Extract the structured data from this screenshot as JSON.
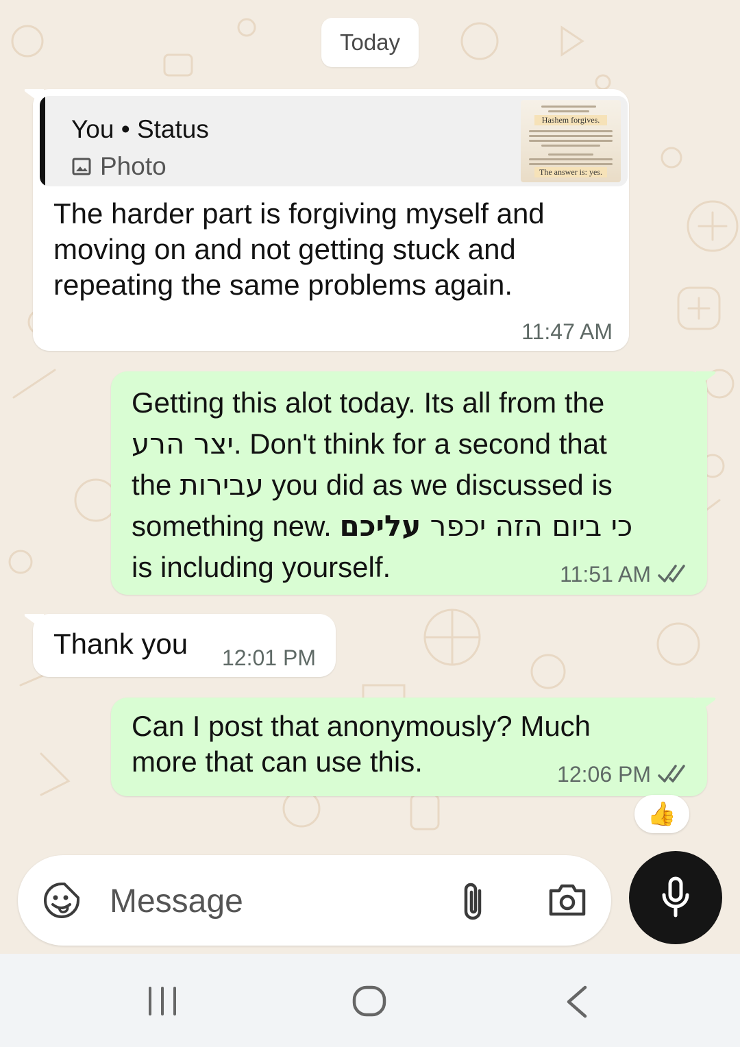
{
  "date_chip": "Today",
  "messages": [
    {
      "quote_author": "You • Status",
      "quote_type": "Photo",
      "text": "The harder part is forgiving myself and moving on and not getting stuck and repeating the same problems again.",
      "time": "11:47 AM"
    },
    {
      "line1": "Getting this alot today. Its all from the",
      "line2_heb": "יצר הרע",
      "line2_rest": ". Don't think for a second that",
      "line3_a": "the",
      "line3_heb": "עבירות",
      "line3_b": "you did as we discussed is",
      "line4_a": "something new.",
      "line4_heb_bold": "עליכם",
      "line4_heb": "כי ביום הזה יכפר",
      "line5": "is including yourself.",
      "time": "11:51 AM"
    },
    {
      "text": "Thank you",
      "time": "12:01 PM"
    },
    {
      "line1": "Can I post that anonymously? Much",
      "line2": "more that can use this.",
      "time": "12:06 PM",
      "reaction": "👍"
    }
  ],
  "status_thumbnail": {
    "heading1": "Hashem forgives.",
    "heading2": "The answer is: yes."
  },
  "input": {
    "placeholder": "Message"
  },
  "icons": {
    "emoji": "sticker-emoji-icon",
    "attach": "paperclip-icon",
    "camera": "camera-icon",
    "mic": "microphone-icon",
    "ticks": "double-check-icon",
    "nav_recents": "recents-icon",
    "nav_home": "home-icon",
    "nav_back": "back-icon"
  },
  "colors": {
    "background": "#f3ece2",
    "incoming_bubble": "#ffffff",
    "outgoing_bubble": "#d9fdd3",
    "mic_button": "#151515"
  }
}
